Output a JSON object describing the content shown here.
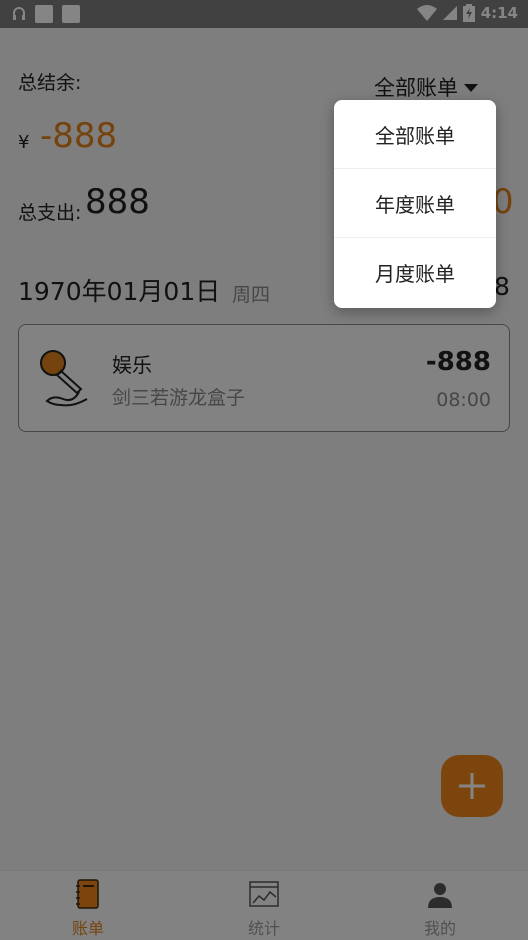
{
  "status_bar": {
    "time": "4:14"
  },
  "summary": {
    "total_balance_label": "总结余:",
    "filter_label": "全部账单",
    "currency_symbol": "¥",
    "balance_value": "-888",
    "expense_label": "总支出:",
    "expense_value": "888",
    "income_partial": "0"
  },
  "day_group": {
    "date": "1970年01月01日",
    "weekday": "周四",
    "right_partial": "8"
  },
  "records": [
    {
      "category": "娱乐",
      "note": "剑三若游龙盒子",
      "amount": "-888",
      "time": "08:00",
      "icon": "microphone-icon"
    }
  ],
  "bottom_nav": [
    {
      "label": "账单",
      "icon": "notebook-icon",
      "active": true
    },
    {
      "label": "统计",
      "icon": "chart-icon",
      "active": false
    },
    {
      "label": "我的",
      "icon": "person-icon",
      "active": false
    }
  ],
  "dropdown": {
    "options": [
      "全部账单",
      "年度账单",
      "月度账单"
    ]
  },
  "colors": {
    "accent": "#e0801a",
    "fab": "#f0851c",
    "scrim": "rgba(0,0,0,0.48)"
  }
}
